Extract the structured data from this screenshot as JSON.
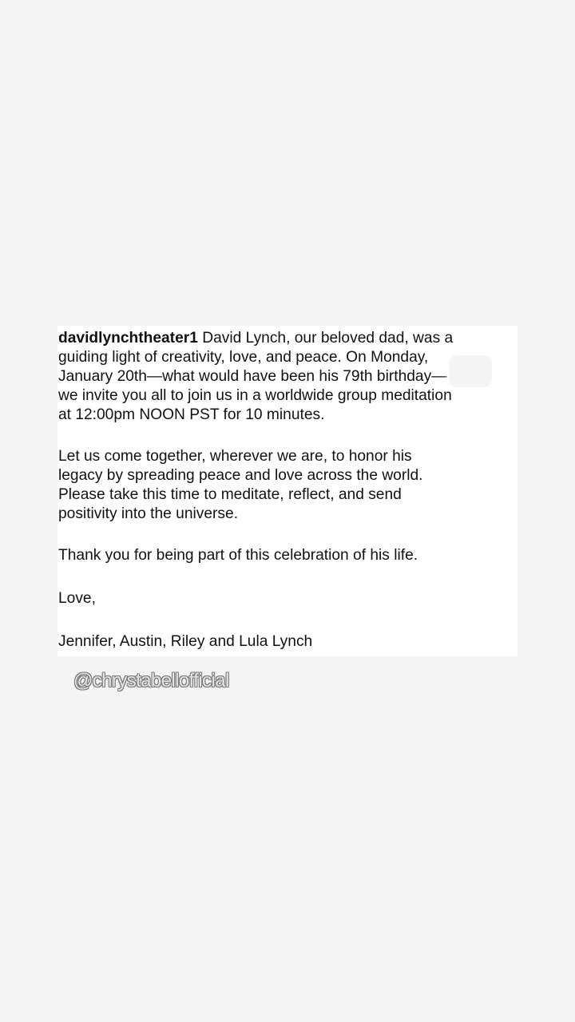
{
  "post": {
    "username": "davidlynchtheater1",
    "paragraph1": {
      "line1_rest": " David Lynch, our beloved dad, was a",
      "line2": "guiding light of creativity, love, and peace. On Monday,",
      "line3": "January 20th—what would have been his 79th birthday—",
      "line4": "we invite you all to join us in a worldwide group meditation",
      "line5": "at 12:00pm NOON PST for 10 minutes."
    },
    "paragraph2": {
      "line1": "Let us come together, wherever we are, to honor his",
      "line2": "legacy by spreading peace and love across the world.",
      "line3": "Please take this time to meditate, reflect, and send",
      "line4": "positivity into the universe."
    },
    "paragraph3": "Thank you for being part of this celebration of his life.",
    "paragraph4": "Love,",
    "paragraph5": "Jennifer, Austin, Riley and Lula Lynch"
  },
  "mention": "@chrystabellofficial"
}
